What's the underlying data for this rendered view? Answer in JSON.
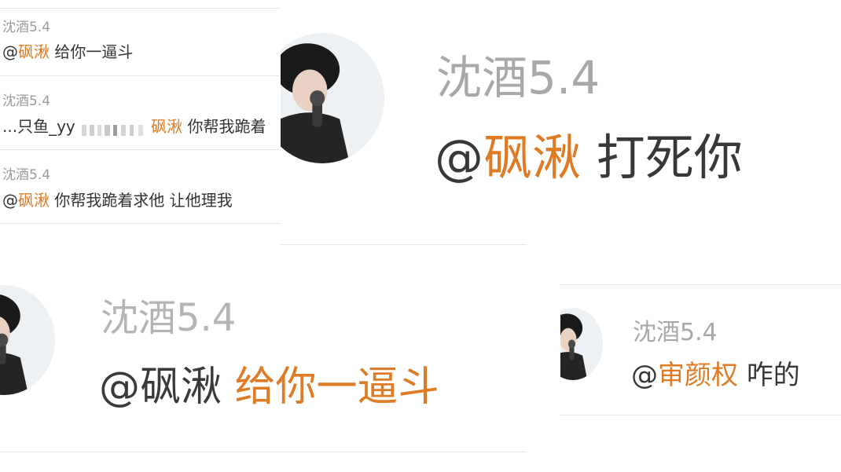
{
  "top_left": {
    "items": [
      {
        "name": "沈酒5.4",
        "prefix": "@",
        "mention": "砜湫",
        "text": " 给你一逼斗"
      },
      {
        "name": "沈酒5.4",
        "lead": "...只鱼_yy",
        "mention": "砜湫",
        "text": " 你帮我跪着"
      },
      {
        "name": "沈酒5.4",
        "prefix": "@",
        "mention": "砜湫",
        "text": " 你帮我跪着求他 让他理我"
      }
    ]
  },
  "top_right": {
    "name": "沈酒5.4",
    "prefix": "@",
    "mention": "砜湫",
    "text": " 打死你"
  },
  "bottom_left": {
    "name": "沈酒5.4",
    "prefix": "@砜湫",
    "highlight": " 给你一逼斗"
  },
  "bottom_right": {
    "name": "沈酒5.4",
    "prefix": "@",
    "mention": "审颜权",
    "text": " 咋的"
  },
  "colors": {
    "mention": "#e07b25",
    "name": "#9a9a9a",
    "text": "#333333"
  },
  "icons": {
    "avatar": "avatar-image"
  }
}
